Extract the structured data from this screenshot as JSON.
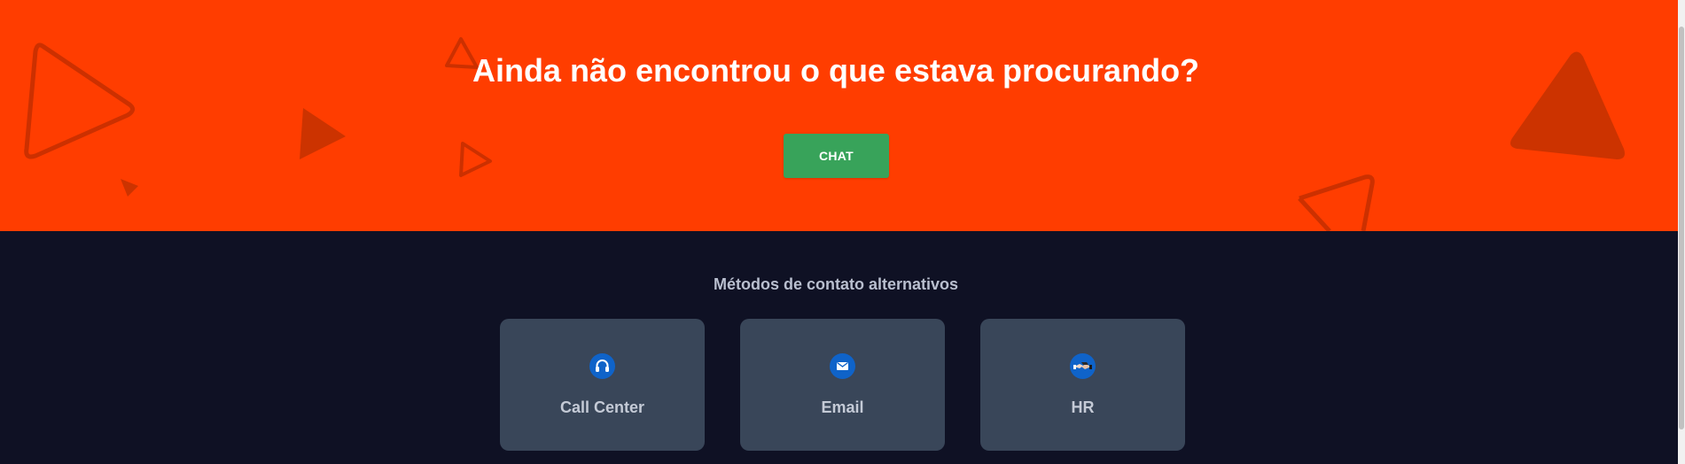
{
  "hero": {
    "title": "Ainda não encontrou o que estava procurando?",
    "chat_label": "CHAT",
    "background_color": "#ff3d00",
    "chat_button_color": "#38a35a"
  },
  "contact": {
    "heading": "Métodos de contato alternativos",
    "background_color": "#0f1124",
    "card_color": "#394659",
    "cards": [
      {
        "icon": "headset-icon",
        "label": "Call Center"
      },
      {
        "icon": "envelope-icon",
        "label": "Email"
      },
      {
        "icon": "handshake-icon",
        "label": "HR"
      }
    ]
  }
}
